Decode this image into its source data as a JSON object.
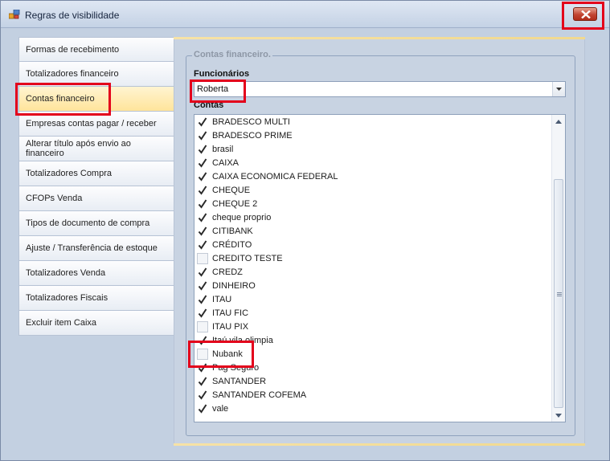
{
  "window": {
    "title": "Regras de visibilidade"
  },
  "nav": {
    "items": [
      {
        "label": "Formas de recebimento",
        "active": false
      },
      {
        "label": "Totalizadores financeiro",
        "active": false
      },
      {
        "label": "Contas financeiro",
        "active": true
      },
      {
        "label": "Empresas contas pagar / receber",
        "active": false
      },
      {
        "label": "Alterar título após envio ao financeiro",
        "active": false
      },
      {
        "label": "Totalizadores Compra",
        "active": false
      },
      {
        "label": "CFOPs Venda",
        "active": false
      },
      {
        "label": "Tipos de documento de compra",
        "active": false
      },
      {
        "label": "Ajuste / Transferência de estoque",
        "active": false
      },
      {
        "label": "Totalizadores Venda",
        "active": false
      },
      {
        "label": "Totalizadores Fiscais",
        "active": false
      },
      {
        "label": "Excluir item Caixa",
        "active": false
      }
    ]
  },
  "panel": {
    "group_title": "Contas financeiro.",
    "employees_label": "Funcionários",
    "employee_selected": "Roberta",
    "accounts_label": "Contas",
    "accounts": [
      {
        "label": "BRADESCO MULTI",
        "checked": true
      },
      {
        "label": "BRADESCO PRIME",
        "checked": true
      },
      {
        "label": "brasil",
        "checked": true
      },
      {
        "label": "CAIXA",
        "checked": true
      },
      {
        "label": "CAIXA ECONOMICA FEDERAL",
        "checked": true
      },
      {
        "label": "CHEQUE",
        "checked": true
      },
      {
        "label": "CHEQUE 2",
        "checked": true
      },
      {
        "label": "cheque proprio",
        "checked": true
      },
      {
        "label": "CITIBANK",
        "checked": true
      },
      {
        "label": "CRÉDITO",
        "checked": true
      },
      {
        "label": "CREDITO TESTE",
        "checked": false
      },
      {
        "label": "CREDZ",
        "checked": true
      },
      {
        "label": "DINHEIRO",
        "checked": true
      },
      {
        "label": "ITAU",
        "checked": true
      },
      {
        "label": "ITAU FIC",
        "checked": true
      },
      {
        "label": "ITAU PIX",
        "checked": false
      },
      {
        "label": "Itaú vila olimpia",
        "checked": true
      },
      {
        "label": "Nubank",
        "checked": false
      },
      {
        "label": "Pag Seguro",
        "checked": true
      },
      {
        "label": "SANTANDER",
        "checked": true
      },
      {
        "label": "SANTANDER COFEMA",
        "checked": true
      },
      {
        "label": "vale",
        "checked": true
      }
    ]
  },
  "colors": {
    "highlight": "#e3001b",
    "active_tab": "#ffe49b",
    "window_bg": "#c3d0e1"
  }
}
